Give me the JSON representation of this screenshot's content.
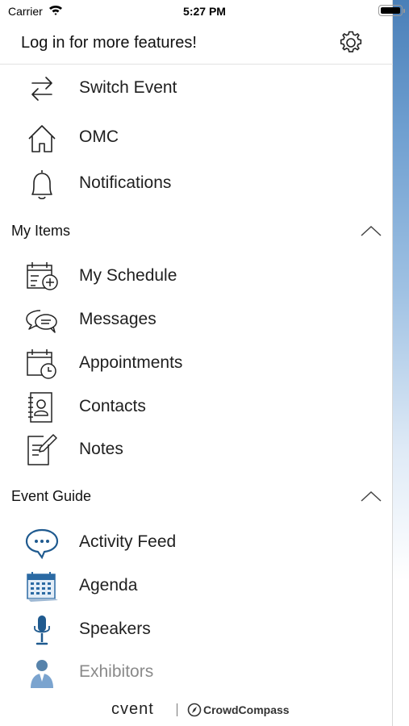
{
  "status_bar": {
    "carrier": "Carrier",
    "time": "5:27 PM"
  },
  "header": {
    "title": "Log in for more features!"
  },
  "top_items": [
    {
      "label": "Switch Event",
      "icon": "switch-icon"
    },
    {
      "label": "OMC",
      "icon": "home-icon"
    },
    {
      "label": "Notifications",
      "icon": "bell-icon"
    }
  ],
  "sections": [
    {
      "title": "My Items",
      "items": [
        {
          "label": "My Schedule",
          "icon": "calendar-add-icon"
        },
        {
          "label": "Messages",
          "icon": "chat-bubbles-icon"
        },
        {
          "label": "Appointments",
          "icon": "calendar-clock-icon"
        },
        {
          "label": "Contacts",
          "icon": "contacts-book-icon"
        },
        {
          "label": "Notes",
          "icon": "note-pencil-icon"
        }
      ]
    },
    {
      "title": "Event Guide",
      "items": [
        {
          "label": "Activity Feed",
          "icon": "speech-bubble-icon"
        },
        {
          "label": "Agenda",
          "icon": "agenda-calendar-icon"
        },
        {
          "label": "Speakers",
          "icon": "microphone-icon"
        },
        {
          "label": "Exhibitors",
          "icon": "person-icon"
        }
      ]
    }
  ],
  "footer": {
    "brand": "cvent",
    "partner": "CrowdCompass"
  },
  "colors": {
    "accent_blue": "#1f5a8f",
    "line_gray": "#222222"
  }
}
